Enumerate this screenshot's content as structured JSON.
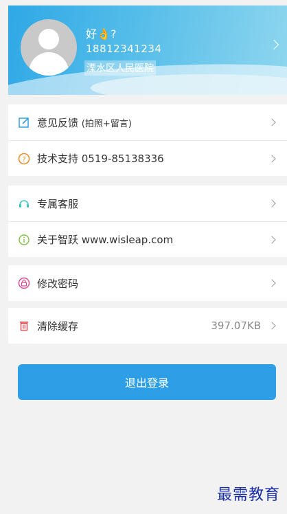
{
  "profile": {
    "greeting": "好",
    "greeting_suffix": "?",
    "phone": "18812341234",
    "hospital": "溧水区人民医院"
  },
  "menu": {
    "feedback": {
      "label": "意见反馈",
      "sub": "(拍照+留言)"
    },
    "support": {
      "label": "技术支持 0519-85138336"
    },
    "service": {
      "label": "专属客服"
    },
    "about": {
      "label": "关于智跃 www.wisleap.com"
    },
    "password": {
      "label": "修改密码"
    },
    "cache": {
      "label": "清除缓存",
      "value": "397.07KB"
    }
  },
  "logout_label": "退出登录",
  "watermark": "最需教育",
  "colors": {
    "accent": "#2e9fe6",
    "feedback_icon": "#2e9fe6",
    "support_icon": "#f08a24",
    "service_icon": "#3ec6c6",
    "about_icon": "#7cc242",
    "password_icon": "#d9468a",
    "cache_icon": "#e0464e"
  },
  "icons": [
    "edit-icon",
    "question-icon",
    "headset-icon",
    "info-icon",
    "lock-icon",
    "trash-icon",
    "chevron-right-icon"
  ]
}
